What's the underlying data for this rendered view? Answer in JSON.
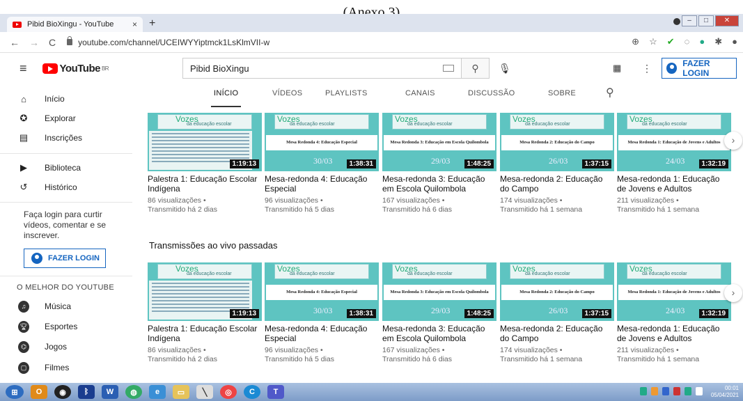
{
  "caption": "(Anexo 3)",
  "browser": {
    "tab_title": "Pibid BioXingu - YouTube",
    "tab_close": "×",
    "new_tab": "+",
    "url": "youtube.com/channel/UCEIWYYiptmck1LsKlmVII-w"
  },
  "header": {
    "logo_text": "YouTube",
    "logo_region": "BR",
    "search_value": "Pibid BioXingu",
    "login_label": "FAZER LOGIN"
  },
  "sidebar": {
    "items": [
      {
        "label": "Início"
      },
      {
        "label": "Explorar"
      },
      {
        "label": "Inscrições"
      },
      {
        "label": "Biblioteca"
      },
      {
        "label": "Histórico"
      }
    ],
    "login_note": "Faça login para curtir vídeos, comentar e se inscrever.",
    "login_label": "FAZER LOGIN",
    "best_of_heading": "O MELHOR DO YOUTUBE",
    "best_items": [
      {
        "label": "Música"
      },
      {
        "label": "Esportes"
      },
      {
        "label": "Jogos"
      },
      {
        "label": "Filmes"
      }
    ]
  },
  "channel_tabs": [
    "INÍCIO",
    "VÍDEOS",
    "PLAYLISTS",
    "CANAIS",
    "DISCUSSÃO",
    "SOBRE"
  ],
  "shelf2_title": "Transmissões ao vivo passadas",
  "videos": [
    {
      "title": "Palestra 1: Educação Escolar Indígena",
      "views": "86 visualizações •",
      "when": "Transmitido há 2 dias",
      "duration": "1:19:13",
      "thumb_heading": "",
      "thumb_date": ""
    },
    {
      "title": "Mesa-redonda 4: Educação Especial",
      "views": "96 visualizações •",
      "when": "Transmitido há 5 dias",
      "duration": "1:38:31",
      "thumb_heading": "Mesa Redonda 4: Educação Especial",
      "thumb_date": "30/03"
    },
    {
      "title": "Mesa-redonda 3: Educação em Escola Quilombola",
      "views": "167 visualizações •",
      "when": "Transmitido há 6 dias",
      "duration": "1:48:25",
      "thumb_heading": "Mesa Redonda 3: Educação em Escola Quilombola",
      "thumb_date": "29/03"
    },
    {
      "title": "Mesa-redonda 2: Educação do Campo",
      "views": "174 visualizações •",
      "when": "Transmitido há 1 semana",
      "duration": "1:37:15",
      "thumb_heading": "Mesa Redonda 2: Educação do Campo",
      "thumb_date": "26/03"
    },
    {
      "title": "Mesa-redonda 1: Educação de Jovens e Adultos",
      "views": "211 visualizações •",
      "when": "Transmitido há 1 semana",
      "duration": "1:32:19",
      "thumb_heading": "Mesa Redonda 1: Educação de Jovens e Adultos",
      "thumb_date": "24/03"
    }
  ],
  "thumb_brand": {
    "vozes": "Vozes",
    "sub": "da educação escolar"
  },
  "taskbar": {
    "time": "00:01",
    "date": "05/04/2021"
  }
}
